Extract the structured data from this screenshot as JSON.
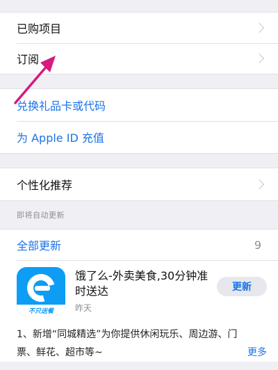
{
  "group1": {
    "purchased": "已购项目",
    "subscriptions": "订阅"
  },
  "group2": {
    "redeem": "兑换礼品卡或代码",
    "add_funds": "为 Apple ID 充值"
  },
  "group3": {
    "personalized": "个性化推荐"
  },
  "updates": {
    "header": "即将自动更新",
    "update_all": "全部更新",
    "count": "9"
  },
  "app": {
    "name": "饿了么-外卖美食,30分钟准时送达",
    "icon_tag": "不只送餐",
    "date": "昨天",
    "update_button": "更新",
    "notes": "1、新增“同城精选”为你提供休闲玩乐、周边游、门票、鲜花、超市等~",
    "more": "更多"
  },
  "colors": {
    "link": "#1a73e8",
    "arrow": "#d6197f",
    "app_icon": "#0d9df5"
  }
}
